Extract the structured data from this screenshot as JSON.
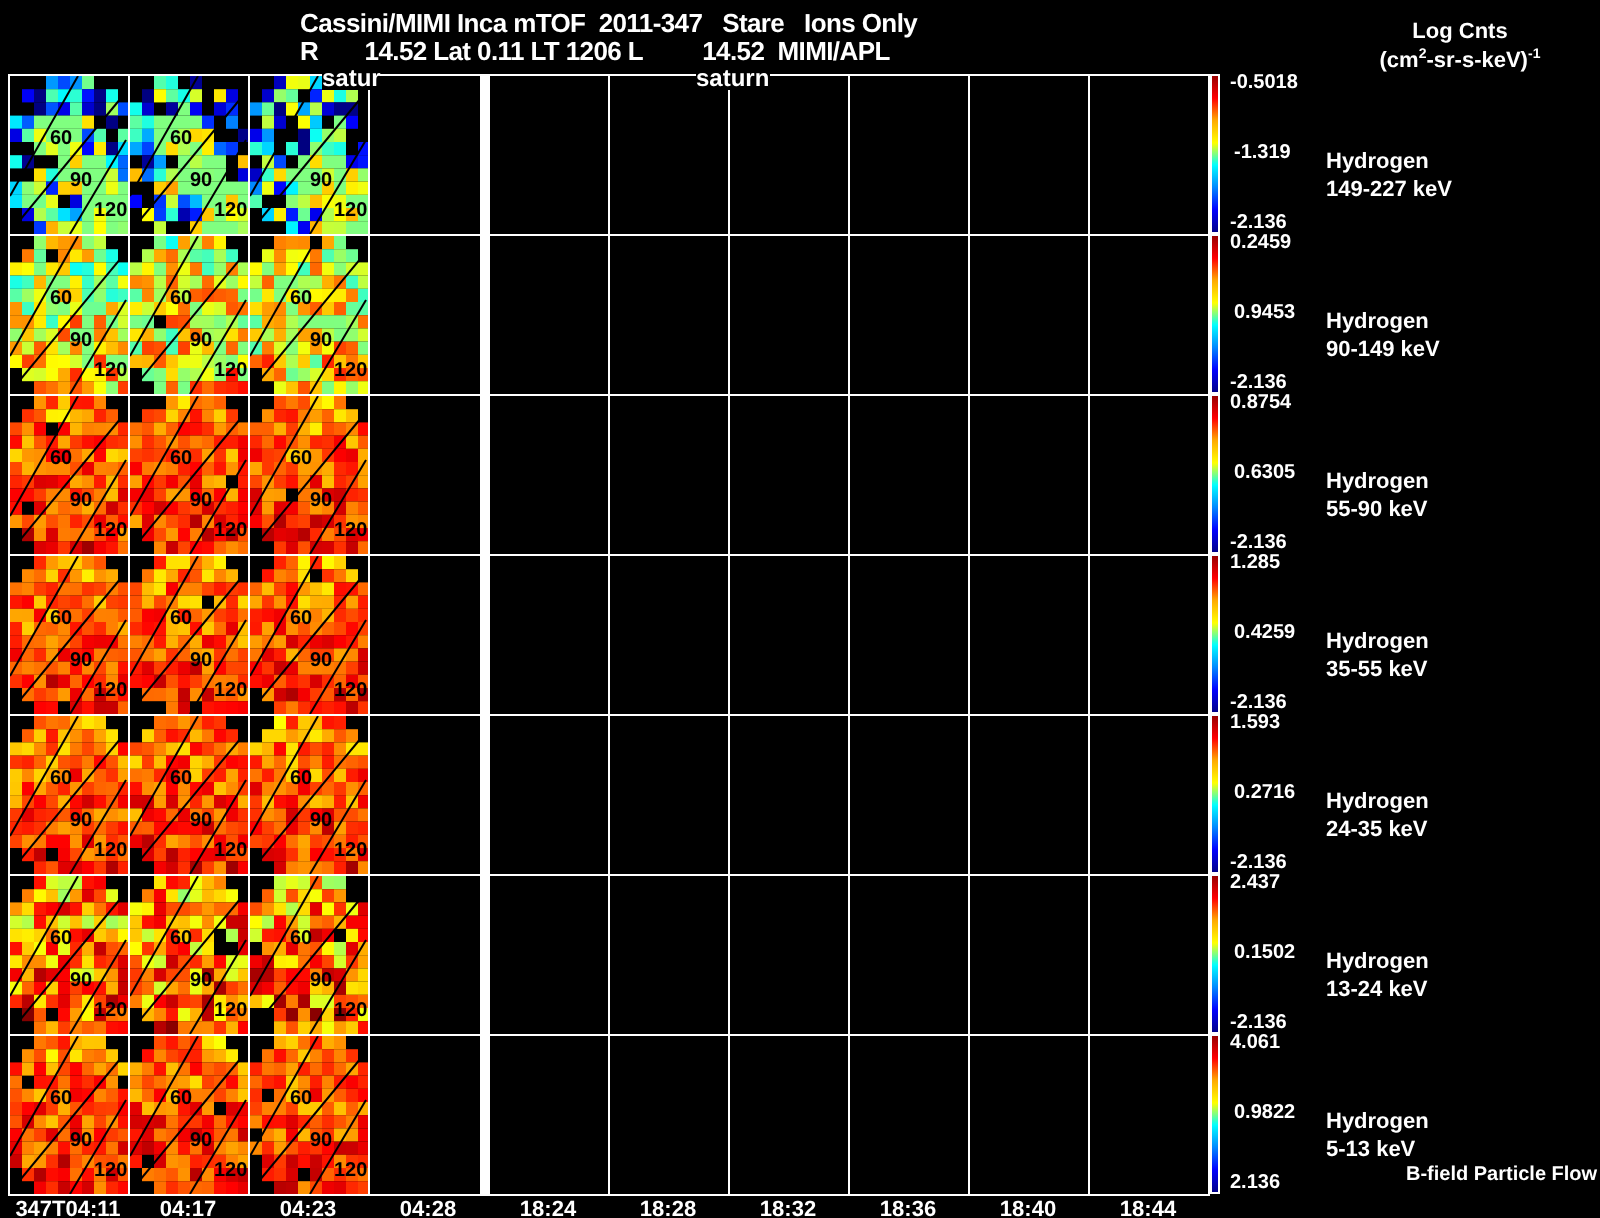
{
  "title": "Cassini/MIMI Inca mTOF  2011-347   Stare   Ions Only",
  "subtitle": "R       14.52 Lat 0.11 LT 1206 L         14.52  MIMI/APL",
  "units": {
    "label": "Log Cnts",
    "unit": "(cm$^{2}$-sr-s-keV)$^{-1}$"
  },
  "markers": [
    "satur",
    "saturn"
  ],
  "rows": [
    {
      "species": "Hydrogen",
      "energy": "149-227 keV",
      "max": "-0.5018",
      "mid": "-1.319",
      "min": "-2.136",
      "kind": "sparse",
      "tiles": [
        {
          "contours": [
            "60",
            "90",
            "120"
          ]
        },
        {
          "contours": [
            "60",
            "90",
            "120"
          ]
        },
        {
          "contours": [
            "90",
            "120"
          ]
        }
      ]
    },
    {
      "species": "Hydrogen",
      "energy": "90-149 keV",
      "max": "0.2459",
      "mid": "0.9453",
      "min": "-2.136",
      "kind": "yellow",
      "tiles": [
        {
          "contours": [
            "60",
            "90",
            "120"
          ]
        },
        {
          "contours": [
            "60",
            "90",
            "120"
          ]
        },
        {
          "contours": [
            "60",
            "90",
            "120"
          ]
        }
      ]
    },
    {
      "species": "Hydrogen",
      "energy": "55-90 keV",
      "max": "0.8754",
      "mid": "0.6305",
      "min": "-2.136",
      "kind": "orange",
      "tiles": [
        {
          "contours": [
            "60",
            "90",
            "120"
          ]
        },
        {
          "contours": [
            "60",
            "90",
            "120"
          ]
        },
        {
          "contours": [
            "60",
            "90",
            "120"
          ]
        }
      ]
    },
    {
      "species": "Hydrogen",
      "energy": "35-55 keV",
      "max": "1.285",
      "mid": "0.4259",
      "min": "-2.136",
      "kind": "orange",
      "tiles": [
        {
          "contours": [
            "60",
            "90",
            "120"
          ]
        },
        {
          "contours": [
            "60",
            "90",
            "120"
          ]
        },
        {
          "contours": [
            "60",
            "90",
            "120"
          ]
        }
      ]
    },
    {
      "species": "Hydrogen",
      "energy": "24-35 keV",
      "max": "1.593",
      "mid": "0.2716",
      "min": "-2.136",
      "kind": "orange",
      "tiles": [
        {
          "contours": [
            "60",
            "90",
            "120"
          ]
        },
        {
          "contours": [
            "60",
            "90",
            "120"
          ]
        },
        {
          "contours": [
            "60",
            "90",
            "120"
          ]
        }
      ]
    },
    {
      "species": "Hydrogen",
      "energy": "13-24 keV",
      "max": "2.437",
      "mid": "0.1502",
      "min": "-2.136",
      "kind": "orangey",
      "tiles": [
        {
          "contours": [
            "60",
            "90",
            "120"
          ]
        },
        {
          "contours": [
            "60",
            "90",
            "120"
          ]
        },
        {
          "contours": [
            "60",
            "90",
            "120"
          ]
        }
      ]
    },
    {
      "species": "Hydrogen",
      "energy": "5-13 keV",
      "max": "4.061",
      "mid": "0.9822",
      "min": "2.136",
      "kind": "orange",
      "tiles": [
        {
          "contours": [
            "60",
            "90",
            "120"
          ]
        },
        {
          "contours": [
            "60",
            "90",
            "120"
          ]
        },
        {
          "contours": [
            "60",
            "90",
            "120"
          ]
        }
      ]
    }
  ],
  "legend": "B-field Particle Flow",
  "times": [
    "347T04:11",
    "04:17",
    "04:23",
    "04:28",
    "18:24",
    "18:28",
    "18:32",
    "18:36",
    "18:40",
    "18:44"
  ]
}
